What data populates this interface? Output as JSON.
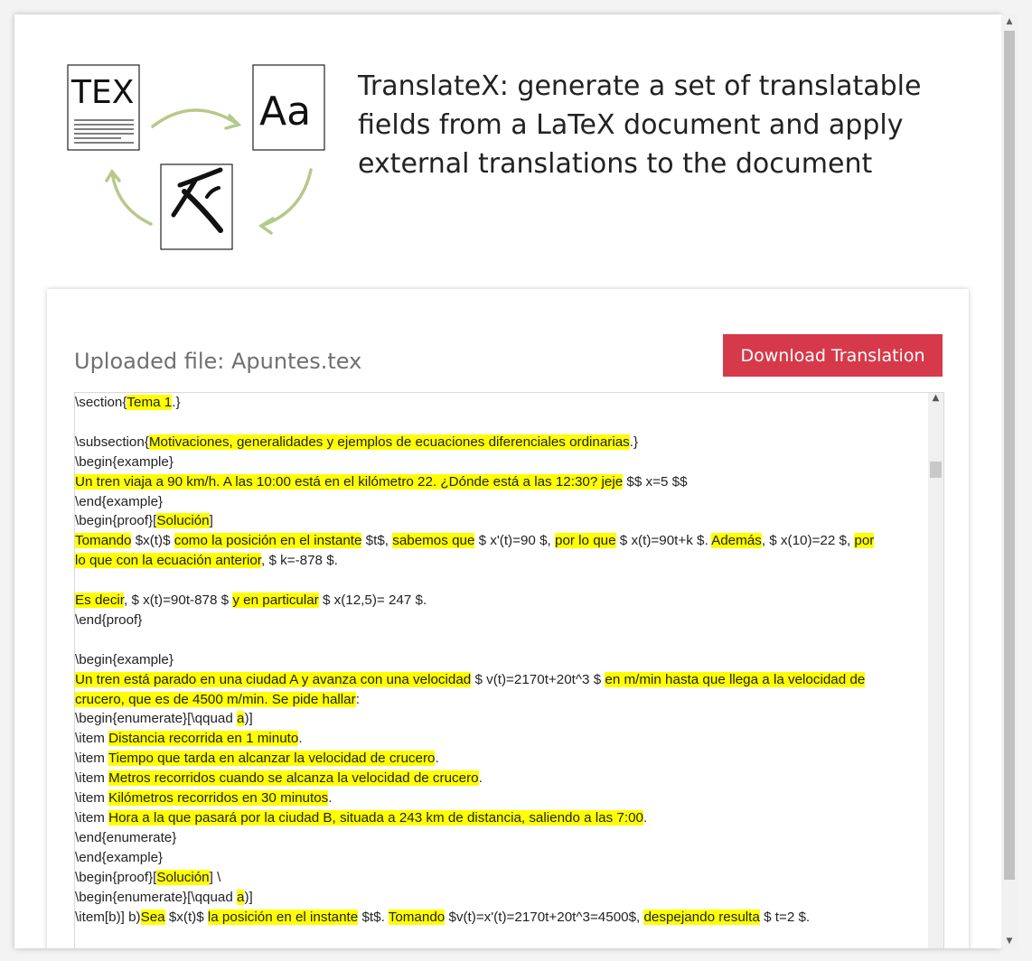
{
  "header": {
    "title": "TranslateX: generate a set of translatable fields from a LaTeX document and apply external translations to the document",
    "logo": {
      "tex_label": "TEX",
      "aa_label": "Aa"
    }
  },
  "card": {
    "uploaded_label": "Uploaded file: Apuntes.tex",
    "download_button": "Download Translation"
  },
  "editor": {
    "lines": [
      [
        [
          "t",
          "\\section{"
        ],
        [
          "h",
          "Tema 1"
        ],
        [
          "t",
          ".}"
        ]
      ],
      [],
      [
        [
          "t",
          "\\subsection{"
        ],
        [
          "h",
          "Motivaciones, generalidades y ejemplos de ecuaciones diferenciales ordinarias"
        ],
        [
          "t",
          ".}"
        ]
      ],
      [
        [
          "t",
          "\\begin{example}"
        ]
      ],
      [
        [
          "h",
          "Un tren viaja a 90 km/h. A las 10:00 está en el kilómetro 22. ¿Dónde está a las 12:30? jeje"
        ],
        [
          "t",
          " $$ x=5 $$"
        ]
      ],
      [
        [
          "t",
          "\\end{example}"
        ]
      ],
      [
        [
          "t",
          "\\begin{proof}["
        ],
        [
          "h",
          "Solución"
        ],
        [
          "t",
          "]"
        ]
      ],
      [
        [
          "h",
          "Tomando"
        ],
        [
          "t",
          " $x(t)$ "
        ],
        [
          "h",
          "como la posición en el instante"
        ],
        [
          "t",
          " $t$, "
        ],
        [
          "h",
          "sabemos que"
        ],
        [
          "t",
          " $ x'(t)=90 $, "
        ],
        [
          "h",
          "por lo que"
        ],
        [
          "t",
          " $ x(t)=90t+k $. "
        ],
        [
          "h",
          "Además"
        ],
        [
          "t",
          ", $ x(10)=22 $, "
        ],
        [
          "h",
          "por"
        ]
      ],
      [
        [
          "h",
          "lo que con la ecuación anterior"
        ],
        [
          "t",
          ", $ k=-878 $."
        ]
      ],
      [],
      [
        [
          "h",
          "Es decir"
        ],
        [
          "t",
          ", $ x(t)=90t-878 $ "
        ],
        [
          "h",
          "y en particular"
        ],
        [
          "t",
          " $ x(12,5)= 247 $."
        ]
      ],
      [
        [
          "t",
          "\\end{proof}"
        ]
      ],
      [],
      [
        [
          "t",
          "\\begin{example}"
        ]
      ],
      [
        [
          "h",
          "Un tren está parado en una ciudad A y avanza con una velocidad"
        ],
        [
          "t",
          " $ v(t)=2170t+20t^3 $ "
        ],
        [
          "h",
          "en m/min hasta que llega a la velocidad de"
        ]
      ],
      [
        [
          "h",
          "crucero, que es de 4500 m/min. Se pide hallar"
        ],
        [
          "t",
          ":"
        ]
      ],
      [
        [
          "t",
          "\\begin{enumerate}[\\qquad "
        ],
        [
          "h",
          "a"
        ],
        [
          "t",
          ")]"
        ]
      ],
      [
        [
          "t",
          "\\item "
        ],
        [
          "h",
          "Distancia recorrida en 1 minuto"
        ],
        [
          "t",
          "."
        ]
      ],
      [
        [
          "t",
          "\\item "
        ],
        [
          "h",
          "Tiempo que tarda en alcanzar la velocidad de crucero"
        ],
        [
          "t",
          "."
        ]
      ],
      [
        [
          "t",
          "\\item "
        ],
        [
          "h",
          "Metros recorridos cuando se alcanza la velocidad de crucero"
        ],
        [
          "t",
          "."
        ]
      ],
      [
        [
          "t",
          "\\item "
        ],
        [
          "h",
          "Kilómetros recorridos en 30 minutos"
        ],
        [
          "t",
          "."
        ]
      ],
      [
        [
          "t",
          "\\item "
        ],
        [
          "h",
          "Hora a la que pasará por la ciudad B, situada a 243 km de distancia, saliendo a las 7:00"
        ],
        [
          "t",
          "."
        ]
      ],
      [
        [
          "t",
          "\\end{enumerate}"
        ]
      ],
      [
        [
          "t",
          "\\end{example}"
        ]
      ],
      [
        [
          "t",
          "\\begin{proof}["
        ],
        [
          "h",
          "Solución"
        ],
        [
          "t",
          "] \\"
        ]
      ],
      [
        [
          "t",
          "\\begin{enumerate}[\\qquad "
        ],
        [
          "h",
          "a"
        ],
        [
          "t",
          ")]"
        ]
      ],
      [
        [
          "t",
          "\\item[b)] b)"
        ],
        [
          "h",
          "Sea"
        ],
        [
          "t",
          " $x(t)$ "
        ],
        [
          "h",
          "la posición en el instante"
        ],
        [
          "t",
          " $t$. "
        ],
        [
          "h",
          "Tomando"
        ],
        [
          "t",
          " $v(t)=x'(t)=2170t+20t^3=4500$, "
        ],
        [
          "h",
          "despejando resulta"
        ],
        [
          "t",
          " $ t=2 $."
        ]
      ]
    ]
  }
}
